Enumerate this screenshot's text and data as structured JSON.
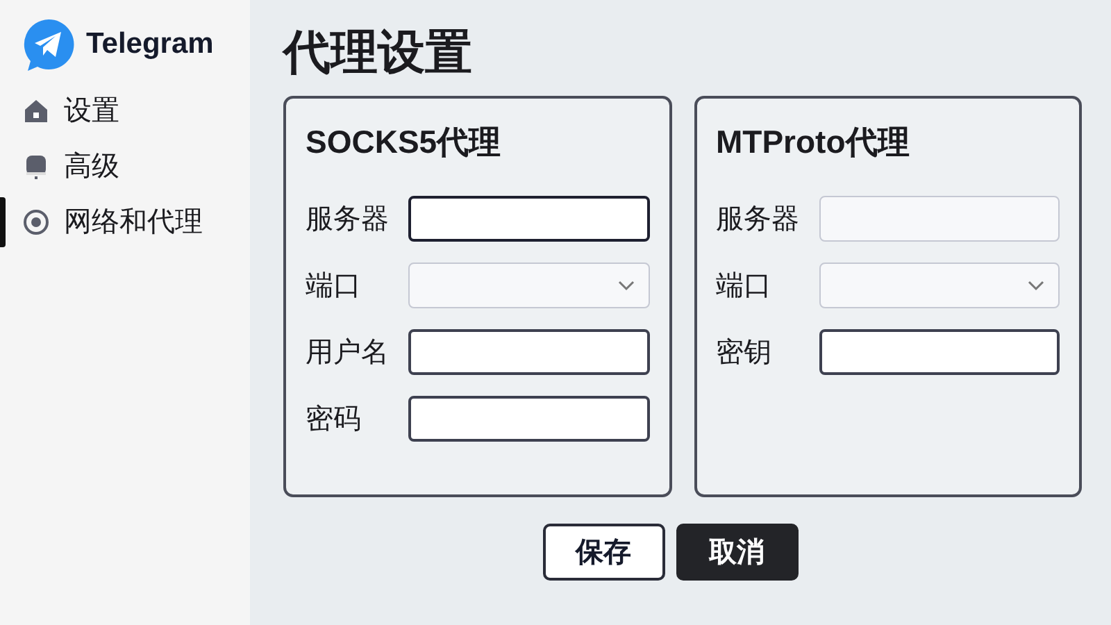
{
  "app": {
    "name": "Telegram"
  },
  "sidebar": {
    "items": [
      {
        "label": "设置",
        "kind": "home",
        "selected": false
      },
      {
        "label": "高级",
        "kind": "device",
        "selected": false
      },
      {
        "label": "网络和代理",
        "kind": "target",
        "selected": true
      }
    ]
  },
  "page_title": "代理设置",
  "panels": [
    {
      "title": "SOCKS5代理",
      "fields": [
        {
          "label": "服务器",
          "kind": "text",
          "disabled": false,
          "focused": true
        },
        {
          "label": "端口",
          "kind": "select",
          "disabled": true,
          "focused": false
        },
        {
          "label": "用户名",
          "kind": "text",
          "disabled": false,
          "focused": false
        },
        {
          "label": "密码",
          "kind": "text",
          "disabled": false,
          "focused": false
        }
      ]
    },
    {
      "title": "MTProto代理",
      "fields": [
        {
          "label": "服务器",
          "kind": "text",
          "disabled": true,
          "focused": false
        },
        {
          "label": "端口",
          "kind": "select",
          "disabled": true,
          "focused": false
        },
        {
          "label": "密钥",
          "kind": "text",
          "disabled": false,
          "focused": false
        }
      ]
    }
  ],
  "buttons": [
    {
      "label": "保存",
      "kind": "outline"
    },
    {
      "label": "取消",
      "kind": "dark"
    }
  ]
}
